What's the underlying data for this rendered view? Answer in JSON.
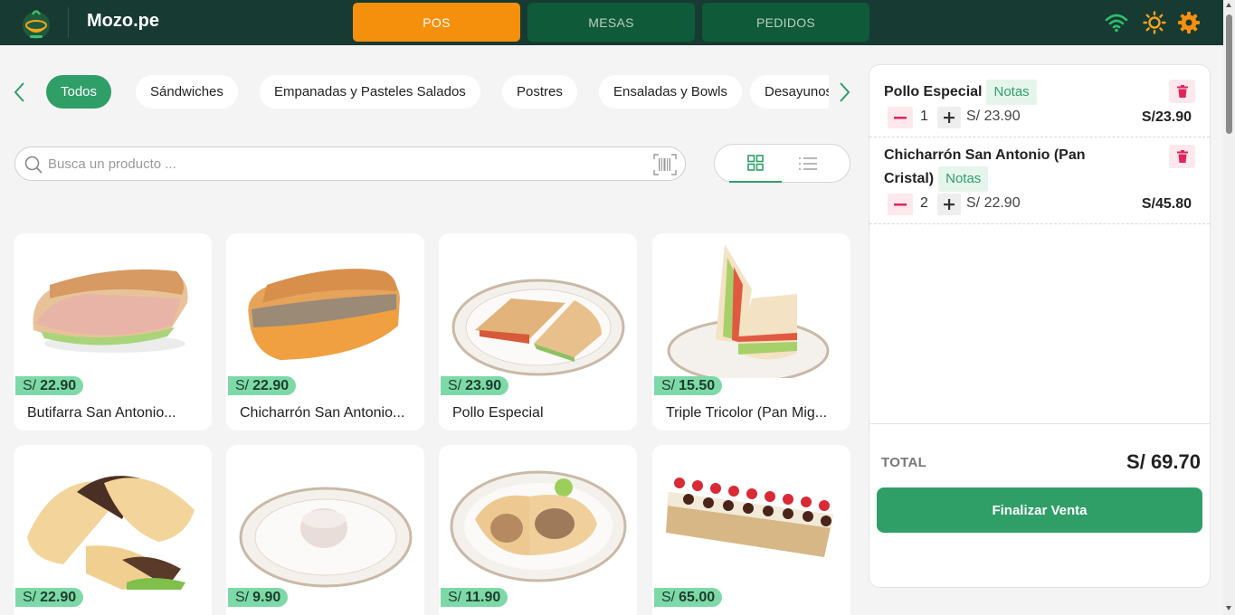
{
  "app": {
    "title": "Mozo.pe"
  },
  "nav": {
    "tabs": [
      {
        "label": "POS"
      },
      {
        "label": "MESAS"
      },
      {
        "label": "PEDIDOS"
      }
    ]
  },
  "categories": [
    "Todos",
    "Sándwiches",
    "Empanadas y Pasteles Salados",
    "Postres",
    "Ensaladas y Bowls",
    "Desayunos"
  ],
  "search": {
    "placeholder": "Busca un producto ..."
  },
  "products": [
    {
      "price_prefix": "S/",
      "price": "22.90",
      "name": "Butifarra San Antonio..."
    },
    {
      "price_prefix": "S/",
      "price": "22.90",
      "name": "Chicharrón San Antonio..."
    },
    {
      "price_prefix": "S/",
      "price": "23.90",
      "name": "Pollo Especial"
    },
    {
      "price_prefix": "S/",
      "price": "15.50",
      "name": "Triple Tricolor (Pan Mig..."
    },
    {
      "price_prefix": "S/",
      "price": "22.90",
      "name": ""
    },
    {
      "price_prefix": "S/",
      "price": "9.90",
      "name": ""
    },
    {
      "price_prefix": "S/",
      "price": "11.90",
      "name": ""
    },
    {
      "price_prefix": "S/",
      "price": "65.00",
      "name": ""
    }
  ],
  "order": {
    "items": [
      {
        "name": "Pollo Especial",
        "notes_label": "Notas",
        "qty": "1",
        "unit_price": "S/ 23.90",
        "line_total": "S/23.90"
      },
      {
        "name_line1": "Chicharrón San Antonio (Pan",
        "name_line2": "Cristal)",
        "notes_label": "Notas",
        "qty": "2",
        "unit_price": "S/ 22.90",
        "line_total": "S/45.80"
      }
    ],
    "total_label": "TOTAL",
    "total_value": "S/ 69.70",
    "finalize_label": "Finalizar Venta"
  },
  "colors": {
    "topbar": "#173a33",
    "accent_green": "#2f9e67",
    "pos_orange": "#f5900d",
    "price_badge": "#7ed9a8"
  },
  "icons": [
    "logo-icon",
    "wifi-icon",
    "sun-icon",
    "gear-icon",
    "chevron-left-icon",
    "chevron-right-icon",
    "search-icon",
    "barcode-icon",
    "grid-view-icon",
    "list-view-icon",
    "trash-icon",
    "minus-icon",
    "plus-icon"
  ]
}
